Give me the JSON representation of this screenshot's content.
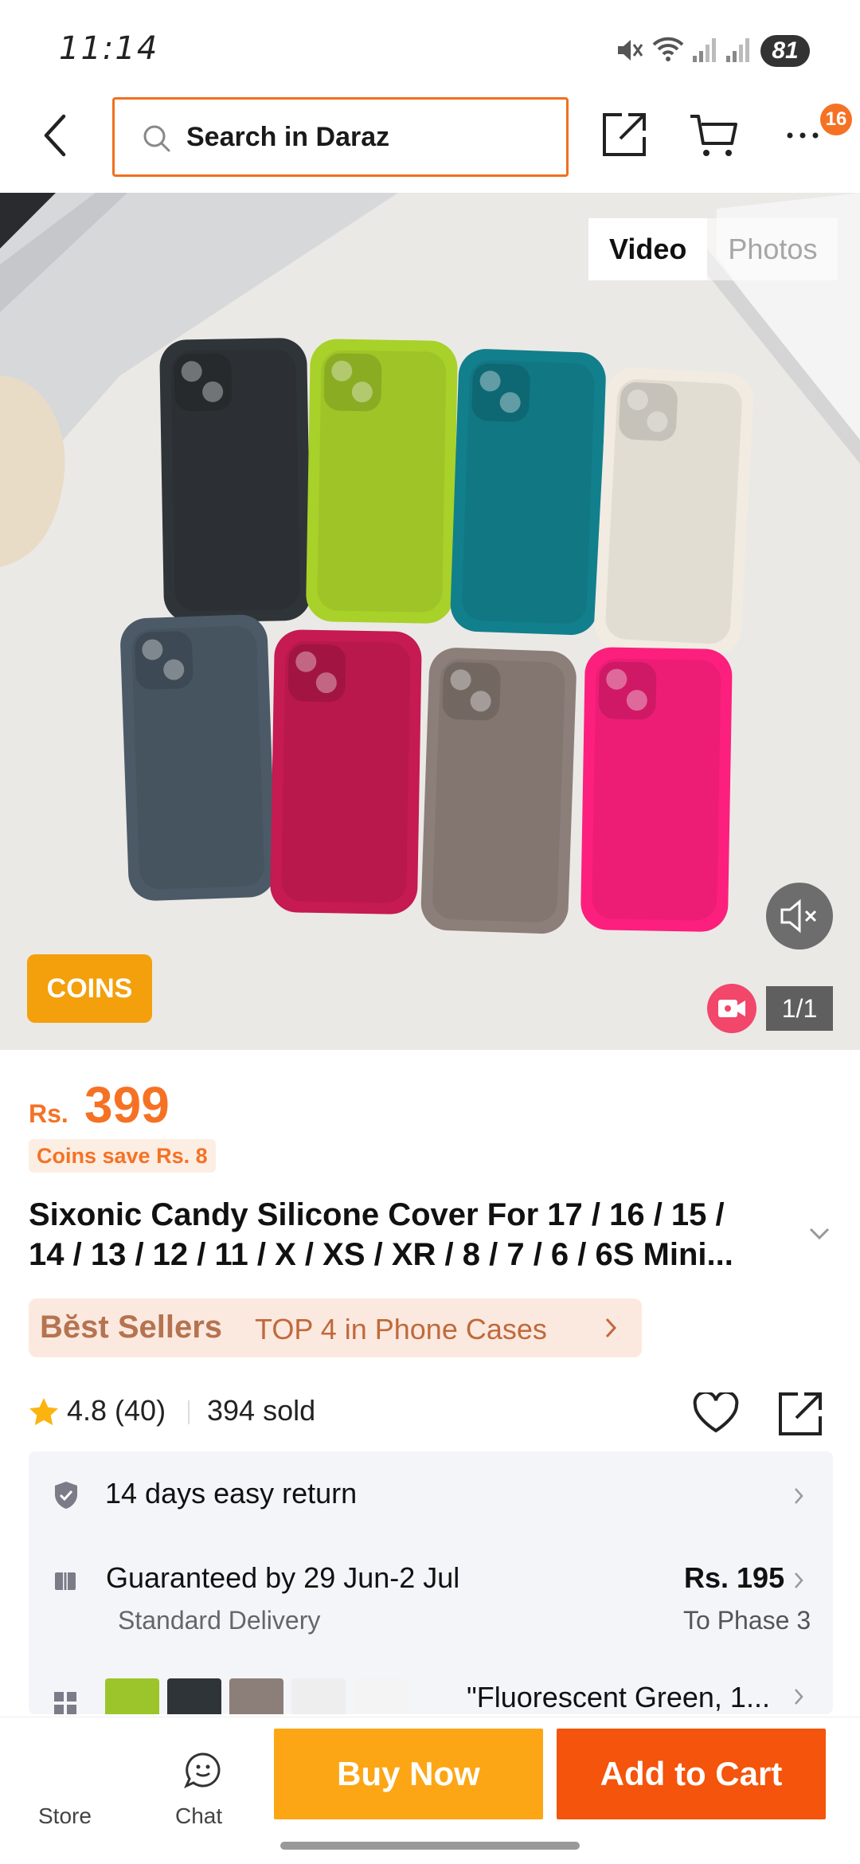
{
  "status_bar": {
    "time": "11:14",
    "battery": "81"
  },
  "header": {
    "search_placeholder": "Search in Daraz",
    "cart_badge": "16"
  },
  "gallery": {
    "tabs": [
      {
        "label": "Video",
        "active": true
      },
      {
        "label": "Photos",
        "active": false
      }
    ],
    "coins_tag": "COINS",
    "page_indicator": "1/1",
    "case_colors": [
      "#2f3438",
      "#a8d12a",
      "#127f8c",
      "#f1ebe1",
      "#4b5a66",
      "#c51a52",
      "#8c7e78",
      "#fc1f7d"
    ]
  },
  "product": {
    "currency": "Rs.",
    "price": "399",
    "coins_save": "Coins save Rs. 8",
    "title_line1": "Sixonic Candy Silicone Cover For 17 / 16 / 15 /",
    "title_line2": "14 / 13 / 12 / 11 / X / XS / XR / 8 / 7 / 6 / 6S Mini...",
    "best_sellers_logo": "Bĕst Sellers",
    "best_sellers_rank": "TOP 4 in Phone Cases",
    "rating": "4.8 (40)",
    "sold": "394 sold"
  },
  "info": {
    "return": "14 days easy return",
    "delivery_guarantee": "Guaranteed by 29 Jun-2 Jul",
    "delivery_type": "Standard Delivery",
    "delivery_fee": "Rs. 195",
    "delivery_destination": "To Phase 3",
    "variant_selected": "\"Fluorescent Green, 1...",
    "variant_thumb_colors": [
      "#9bc52a",
      "#2f3438",
      "#8c7e78",
      "#eeeeee",
      "#f4f4f4"
    ]
  },
  "bottom_bar": {
    "store_label": "Store",
    "chat_label": "Chat",
    "buy_now": "Buy Now",
    "add_to_cart": "Add to Cart"
  },
  "colors": {
    "accent": "#f57224",
    "buy_now": "#fca616",
    "add_to_cart": "#f4540b"
  }
}
